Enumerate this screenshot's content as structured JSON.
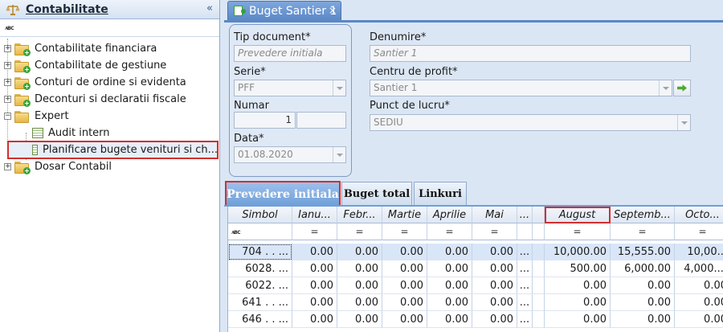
{
  "left_panel": {
    "title": "Contabilitate",
    "collapse_glyph": "«",
    "filter_icon": "abc-filter-icon",
    "tree": [
      {
        "label": "Contabilitate financiara",
        "expander": "+"
      },
      {
        "label": "Contabilitate de gestiune",
        "expander": "+"
      },
      {
        "label": "Conturi de ordine si evidenta",
        "expander": "+"
      },
      {
        "label": "Deconturi si declaratii fiscale",
        "expander": "+"
      },
      {
        "label": "Expert",
        "expander": "−"
      },
      {
        "label": "Audit intern"
      },
      {
        "label": "Planificare bugete venituri si ch..."
      },
      {
        "label": "Dosar Contabil",
        "expander": "+"
      }
    ]
  },
  "document_tab": {
    "label": "Buget Santier 1",
    "close": "×"
  },
  "form": {
    "tip_document_label": "Tip document*",
    "tip_document_value": "Prevedere initiala",
    "serie_label": "Serie*",
    "serie_value": "PFF",
    "numar_label": "Numar",
    "numar_value": "1",
    "data_label": "Data*",
    "data_value": "01.08.2020",
    "denumire_label": "Denumire*",
    "denumire_value": "Santier 1",
    "centru_label": "Centru de profit*",
    "centru_value": "Santier 1",
    "punct_label": "Punct de lucru*",
    "punct_value": "SEDIU"
  },
  "subtabs": [
    "Prevedere initiala",
    "Buget total",
    "Linkuri"
  ],
  "grid": {
    "columns": [
      "Simbol",
      "Ianu...",
      "Febr...",
      "Martie",
      "Aprilie",
      "Mai",
      "...",
      "August",
      "Septemb...",
      "Octo..."
    ],
    "filter_symbol": "=",
    "rows": [
      [
        "704 . . ...",
        "0.00",
        "0.00",
        "0.00",
        "0.00",
        "0.00",
        "...",
        "10,000.00",
        "15,555.00",
        "10,00..."
      ],
      [
        "6028. ...",
        "0.00",
        "0.00",
        "0.00",
        "0.00",
        "0.00",
        "...",
        "500.00",
        "6,000.00",
        "4,000...."
      ],
      [
        "6022. ...",
        "0.00",
        "0.00",
        "0.00",
        "0.00",
        "0.00",
        "...",
        "0.00",
        "0.00",
        "0.00"
      ],
      [
        "641 . . ...",
        "0.00",
        "0.00",
        "0.00",
        "0.00",
        "0.00",
        "...",
        "0.00",
        "0.00",
        "0.00"
      ],
      [
        "646 . . ...",
        "0.00",
        "0.00",
        "0.00",
        "0.00",
        "0.00",
        "...",
        "0.00",
        "0.00",
        "0.00"
      ]
    ]
  },
  "colors": {
    "accent": "#5b88c7",
    "highlight_border": "#d32f2f",
    "panel_bg": "#dbe6f4"
  }
}
